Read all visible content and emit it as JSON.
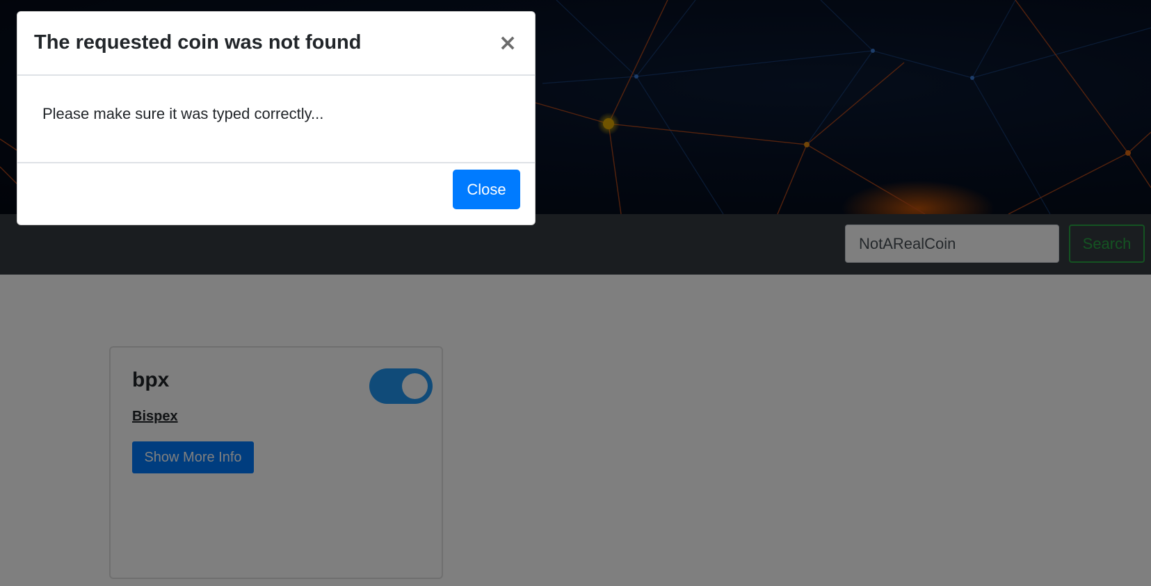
{
  "navbar": {
    "search_value": "NotARealCoin",
    "search_button_label": "Search"
  },
  "coin_card": {
    "symbol": "bpx",
    "name": "Bispex",
    "more_info_label": "Show More Info",
    "toggle_on": true
  },
  "modal": {
    "title": "The requested coin was not found",
    "close_icon": "×",
    "message": "Please make sure it was typed correctly...",
    "close_button_label": "Close"
  },
  "colors": {
    "primary": "#007bff",
    "success": "#28a745",
    "navbar": "#343a40",
    "toggle": "#2196f3"
  },
  "icons": {
    "modal_close": "close-icon"
  }
}
